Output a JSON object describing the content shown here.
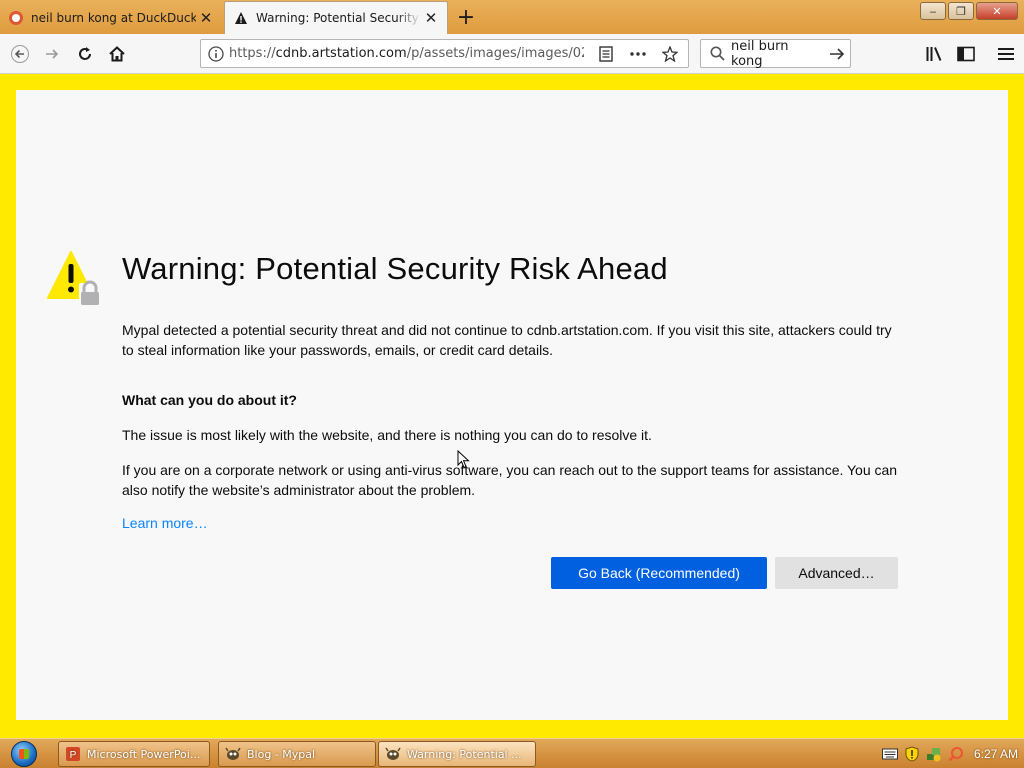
{
  "browser": {
    "tabs": [
      {
        "title": "neil burn kong at DuckDuckGo",
        "favicon": "duckduckgo-icon",
        "active": false
      },
      {
        "title": "Warning: Potential Security Risk Ahead",
        "favicon": "warning-icon",
        "active": true
      }
    ],
    "new_tab_label": "+",
    "url": {
      "scheme": "https://",
      "host": "cdnb.artstation.com",
      "path": "/p/assets/images/images/02..."
    },
    "search_value": "neil burn kong",
    "window_controls": {
      "minimize": "‒",
      "restore": "❐",
      "close": "✕"
    }
  },
  "error_page": {
    "title": "Warning: Potential Security Risk Ahead",
    "intro": "Mypal detected a potential security threat and did not continue to cdnb.artstation.com. If you visit this site, attackers could try to steal information like your passwords, emails, or credit card details.",
    "what_heading": "What can you do about it?",
    "para_1": "The issue is most likely with the website, and there is nothing you can do to resolve it.",
    "para_2": "If you are on a corporate network or using anti-virus software, you can reach out to the support teams for assistance. You can also notify the website’s administrator about the problem.",
    "learn_more": "Learn more…",
    "go_back_label": "Go Back (Recommended)",
    "advanced_label": "Advanced…"
  },
  "taskbar": {
    "items": [
      {
        "label": "Microsoft PowerPoi...",
        "icon": "powerpoint-icon",
        "active": false
      },
      {
        "label": "Blog - Mypal",
        "icon": "mypal-icon",
        "active": false
      },
      {
        "label": "Warning: Potential ...",
        "icon": "mypal-icon",
        "active": true
      }
    ],
    "clock": "6:27 AM"
  },
  "colors": {
    "page_background": "#ffea00",
    "primary_button": "#0060df",
    "link": "#0a84ff",
    "warning_yellow": "#ffe900"
  }
}
